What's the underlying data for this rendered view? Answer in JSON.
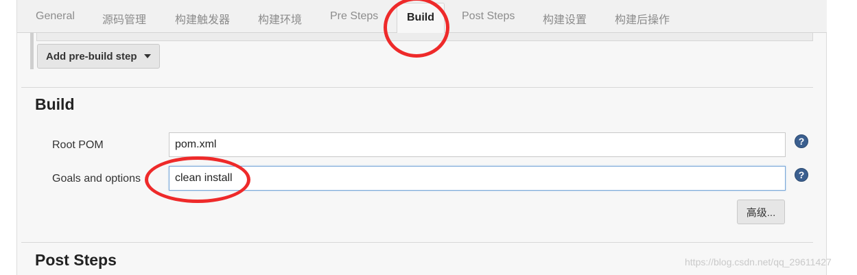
{
  "tabs": [
    {
      "label": "General",
      "active": false
    },
    {
      "label": "源码管理",
      "active": false
    },
    {
      "label": "构建触发器",
      "active": false
    },
    {
      "label": "构建环境",
      "active": false
    },
    {
      "label": "Pre Steps",
      "active": false
    },
    {
      "label": "Build",
      "active": true
    },
    {
      "label": "Post Steps",
      "active": false
    },
    {
      "label": "构建设置",
      "active": false
    },
    {
      "label": "构建后操作",
      "active": false
    }
  ],
  "pre_steps": {
    "add_button_label": "Add pre-build step"
  },
  "build": {
    "title": "Build",
    "root_pom": {
      "label": "Root POM",
      "value": "pom.xml"
    },
    "goals": {
      "label": "Goals and options",
      "value": "clean install"
    },
    "help_symbol": "?",
    "advanced_label": "高级..."
  },
  "post_steps": {
    "title": "Post Steps"
  },
  "watermark": "https://blog.csdn.net/qq_29611427",
  "colors": {
    "annotation": "#ee2a2a",
    "help_icon": "#3b5f8f"
  }
}
